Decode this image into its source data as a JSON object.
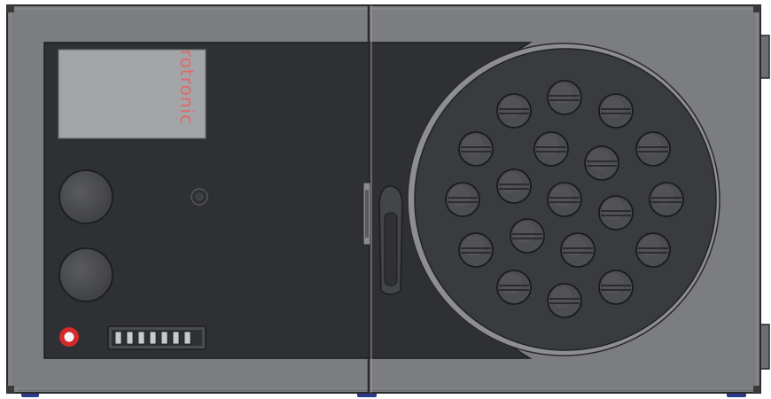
{
  "device": {
    "brand_label": "rotronic",
    "colors": {
      "housing": "#7c7d80",
      "housing_edge": "#2a2a2c",
      "panel": "#2f3033",
      "screen": "#a4a5a8",
      "brand_text": "#e06a6a",
      "knob": "#4a4b4e",
      "dial": "#3a3b3e",
      "plug_head": "#4c4d50",
      "power_ring": "#d42a2a",
      "foot": "#2b3a8a"
    },
    "icons": {
      "power": "power-icon",
      "usb": "usb-port-icon"
    }
  }
}
